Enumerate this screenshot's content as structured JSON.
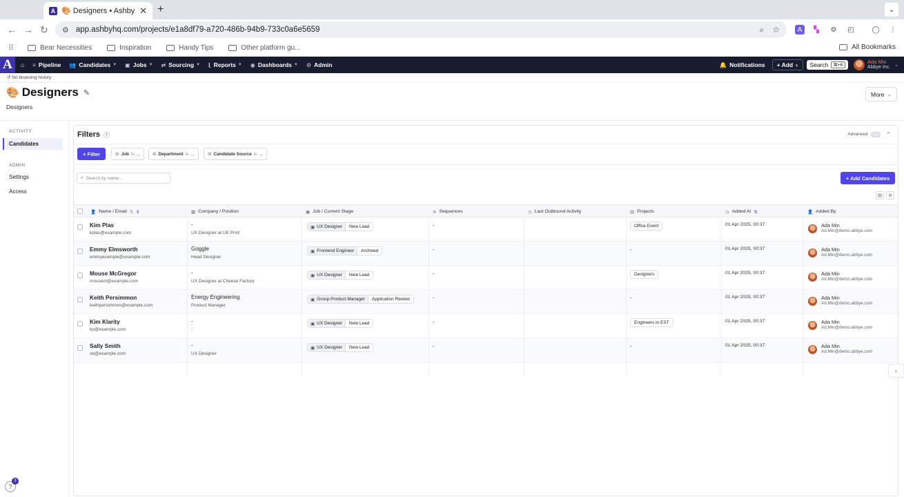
{
  "browser": {
    "tab_title": "🎨 Designers • Ashby",
    "tab_favicon": "A",
    "url": "app.ashbyhq.com/projects/e1a8df79-a720-486b-94b9-733c0a6e5659",
    "bookmarks": [
      "Bear Necessities",
      "Inspiration",
      "Handy Tips",
      "Other platform gu..."
    ],
    "all_bookmarks": "All Bookmarks"
  },
  "appbar": {
    "logo": "A",
    "nav": [
      "Pipeline",
      "Candidates",
      "Jobs",
      "Sourcing",
      "Reports",
      "Dashboards",
      "Admin"
    ],
    "notifications": "Notifications",
    "add": "+ Add",
    "search": "Search",
    "search_kbd": "⌘+K",
    "user_name": "Ada Min",
    "user_org": "Abbye Inc."
  },
  "history_note": "No browsing history",
  "page": {
    "emoji": "🎨",
    "title": "Designers",
    "subtitle": "Designers",
    "more": "More"
  },
  "sidebar": {
    "activity_label": "ACTIVITY",
    "candidates": "Candidates",
    "admin_label": "ADMIN",
    "settings": "Settings",
    "access": "Access"
  },
  "filters": {
    "title": "Filters",
    "advanced": "Advanced",
    "filter_btn": "+ Filter",
    "chips": [
      {
        "field": "Job",
        "op": "is",
        "val": "..."
      },
      {
        "field": "Department",
        "op": "is",
        "val": "..."
      },
      {
        "field": "Candidate Source",
        "op": "is",
        "val": "..."
      }
    ],
    "search_placeholder": "Search by name...",
    "add_candidates": "+ Add Candidates"
  },
  "table": {
    "headers": [
      "Name / Email",
      "Company / Position",
      "Job / Current Stage",
      "Sequences",
      "Last Outbound Activity",
      "Projects",
      "Added At",
      "Added By"
    ],
    "rows": [
      {
        "name": "Kim Plas",
        "email": "kplas@example.com",
        "company": "-",
        "position": "UX Designer at UK Print",
        "job": "UX Designer",
        "stage": "New Lead",
        "sequences": "-",
        "last_outbound": "",
        "project": "Office Event",
        "added_at": "01 Apr 2025, 00:37",
        "added_by": "Ada Min",
        "added_by_email": "Ad.Min@demo.abbye.com"
      },
      {
        "name": "Emmy Elmsworth",
        "email": "emmyexample@example.com",
        "company": "Goggle",
        "position": "Head Designer",
        "job": "Frontend Engineer",
        "stage": "Archived",
        "sequences": "-",
        "last_outbound": "",
        "project": "-",
        "added_at": "01 Apr 2025, 00:37",
        "added_by": "Ada Min",
        "added_by_email": "Ad.Min@demo.abbye.com"
      },
      {
        "name": "Mouse McGregor",
        "email": "mousem@example.com",
        "company": "-",
        "position": "UX Designer at Cheese Factory",
        "job": "UX Designer",
        "stage": "New Lead",
        "sequences": "-",
        "last_outbound": "",
        "project": "Designers",
        "added_at": "01 Apr 2025, 00:37",
        "added_by": "Ada Min",
        "added_by_email": "Ad.Min@demo.abbye.com"
      },
      {
        "name": "Keith Persimmon",
        "email": "keithpersimmon@example.com",
        "company": "Energy Engineering",
        "position": "Product Manager",
        "job": "Group Product Manager",
        "stage": "Application Review",
        "sequences": "-",
        "last_outbound": "",
        "project": "-",
        "added_at": "01 Apr 2025, 00:37",
        "added_by": "Ada Min",
        "added_by_email": "Ad.Min@demo.abbye.com"
      },
      {
        "name": "Kim Klarity",
        "email": "kp@example.com",
        "company": "-",
        "position": "-",
        "job": "UX Designer",
        "stage": "New Lead",
        "sequences": "-",
        "last_outbound": "",
        "project": "Engineers in EST",
        "added_at": "01 Apr 2025, 00:37",
        "added_by": "Ada Min",
        "added_by_email": "Ad.Min@demo.abbye.com"
      },
      {
        "name": "Sally Smith",
        "email": "sb@example.com",
        "company": "-",
        "position": "UX Designer",
        "job": "UX Designer",
        "stage": "New Lead",
        "sequences": "-",
        "last_outbound": "",
        "project": "-",
        "added_at": "01 Apr 2025, 00:37",
        "added_by": "Ada Min",
        "added_by_email": "Ad.Min@demo.abbye.com"
      }
    ]
  },
  "help_badge": "3",
  "colors": {
    "accent": "#4f46e5",
    "appbar": "#191b2f",
    "logo": "#3d32a8"
  }
}
